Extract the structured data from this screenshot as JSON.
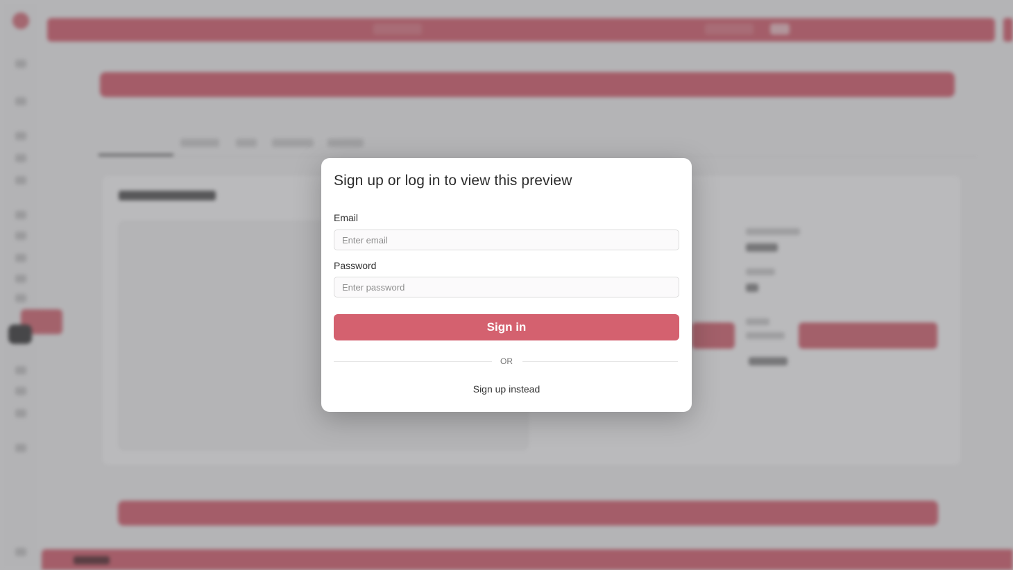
{
  "modal": {
    "title": "Sign up or log in to view this preview",
    "email": {
      "label": "Email",
      "placeholder": "Enter email",
      "value": ""
    },
    "password": {
      "label": "Password",
      "placeholder": "Enter password",
      "value": ""
    },
    "signin_label": "Sign in",
    "divider_text": "OR",
    "signup_label": "Sign up instead"
  },
  "colors": {
    "accent": "#d4616f",
    "overlay": "#5a5a5f"
  }
}
